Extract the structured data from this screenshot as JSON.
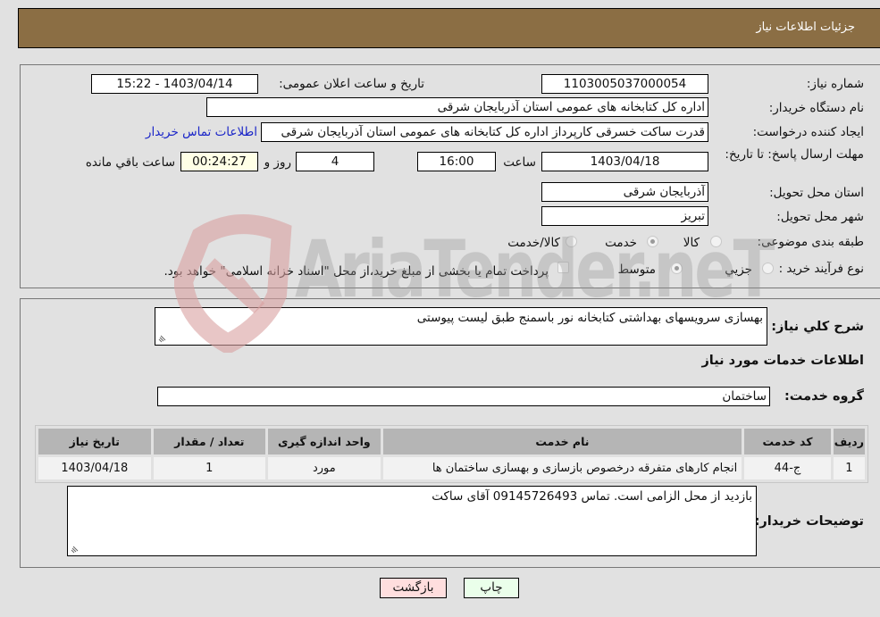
{
  "header": {
    "title": "جزئیات اطلاعات نیاز"
  },
  "form": {
    "need_number": {
      "label": "شماره نیاز:",
      "value": "1103005037000054"
    },
    "announce_datetime": {
      "label": "تاریخ و ساعت اعلان عمومی:",
      "value": "1403/04/14 - 15:22"
    },
    "buyer_org": {
      "label": "نام دستگاه خریدار:",
      "value": "اداره کل کتابخانه های عمومی استان آذربایجان شرقی"
    },
    "requester": {
      "label": "ایجاد کننده درخواست:",
      "value": "قدرت ساکت خسرقی کارپرداز اداره کل کتابخانه های عمومی استان آذربایجان شرقی"
    },
    "buyer_contact_link": "اطلاعات تماس خریدار",
    "deadline": {
      "label": "مهلت ارسال پاسخ: تا تاریخ:",
      "date": "1403/04/18",
      "time_label": "ساعت",
      "time": "16:00",
      "days": "4",
      "days_label": "روز و",
      "remaining": "00:24:27",
      "remaining_label": "ساعت باقي مانده"
    },
    "delivery_province": {
      "label": "استان محل تحویل:",
      "value": "آذربایجان شرقی"
    },
    "delivery_city": {
      "label": "شهر محل تحویل:",
      "value": "تبریز"
    },
    "category": {
      "label": "طبقه بندی موضوعی:",
      "options": [
        "کالا",
        "خدمت",
        "کالا/خدمت"
      ],
      "selected": "خدمت"
    },
    "purchase_type": {
      "label": "نوع فرآیند خرید :",
      "options": [
        "جزيي",
        "متوسط"
      ],
      "selected": "متوسط",
      "treasury_checkbox_label": "پرداخت تمام یا بخشی از مبلغ خرید،از محل \"اسناد خزانه اسلامی\" خواهد بود.",
      "treasury_checked": false
    }
  },
  "details": {
    "summary_label": "شرح کلي نياز:",
    "summary_value": "بهسازی سرویسهای بهداشتی کتابخانه نور باسمنج طبق لیست پیوستی",
    "services_heading": "اطلاعات خدمات مورد نیاز",
    "service_group_label": "گروه خدمت:",
    "service_group_value": "ساختمان",
    "table": {
      "headers": [
        "ردیف",
        "کد خدمت",
        "نام خدمت",
        "واحد اندازه گیری",
        "تعداد / مقدار",
        "تاریخ نیاز"
      ],
      "rows": [
        [
          "1",
          "ج-44",
          "انجام کارهای متفرقه درخصوص بازسازی و بهسازی ساختمان ها",
          "مورد",
          "1",
          "1403/04/18"
        ]
      ]
    },
    "buyer_notes_label": "توضیحات خریدار:",
    "buyer_notes_value": "بازدید از محل الزامی است. تماس  09145726493 آقای ساکت"
  },
  "buttons": {
    "print": "چاپ",
    "back": "بازگشت"
  },
  "colors": {
    "header_bg": "#8b6e44",
    "print_bg": "#eaffea",
    "back_bg": "#ffdede",
    "link": "#1a25c8"
  },
  "watermark": "AriaTender.neT"
}
